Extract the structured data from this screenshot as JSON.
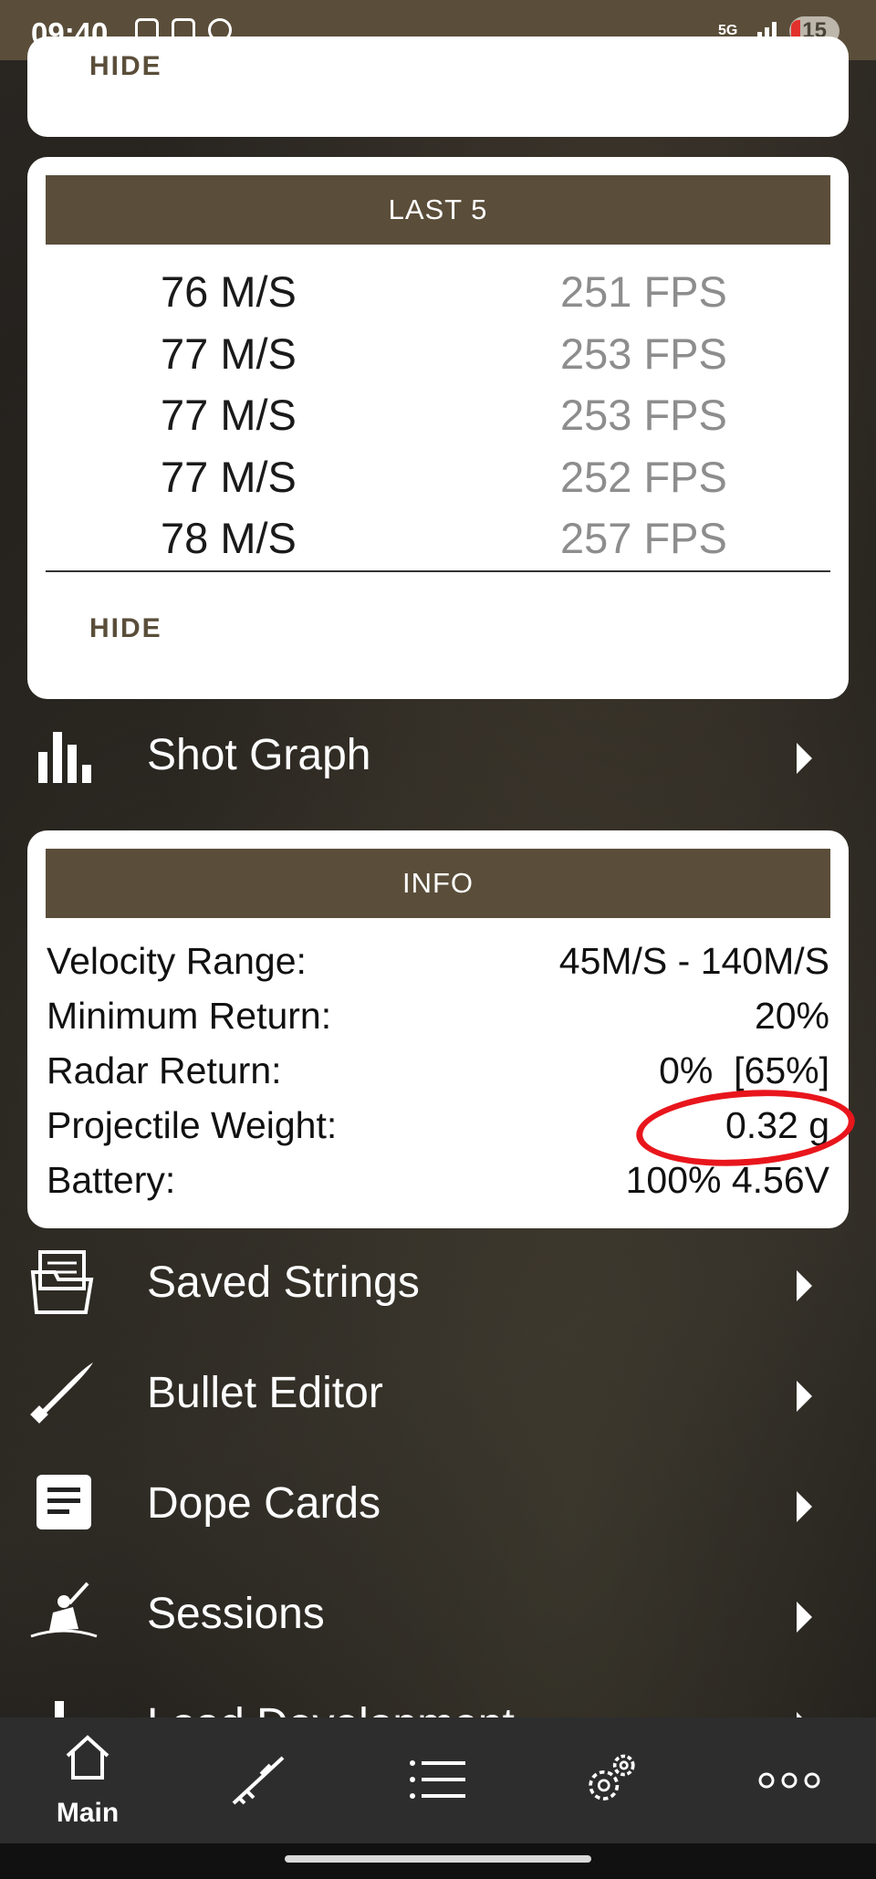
{
  "status_bar": {
    "time": "09:40",
    "network": "5G",
    "battery": "15"
  },
  "hide_label": "HIDE",
  "last5": {
    "title": "LAST 5",
    "rows": [
      {
        "ms": "76 M/S",
        "fps": "251 FPS"
      },
      {
        "ms": "77 M/S",
        "fps": "253 FPS"
      },
      {
        "ms": "77 M/S",
        "fps": "253 FPS"
      },
      {
        "ms": "77 M/S",
        "fps": "252 FPS"
      },
      {
        "ms": "78 M/S",
        "fps": "257 FPS"
      }
    ],
    "hide_label": "HIDE"
  },
  "shot_graph": {
    "label": "Shot Graph",
    "icon": "bar-chart-icon"
  },
  "info": {
    "title": "INFO",
    "rows": [
      {
        "key": "Velocity Range:",
        "value": "45M/S - 140M/S"
      },
      {
        "key": "Minimum Return:",
        "value": "20%"
      },
      {
        "key": "Radar Return:",
        "value": "0%  [65%]"
      },
      {
        "key": "Projectile Weight:",
        "value": "0.32 g"
      },
      {
        "key": "Battery:",
        "value": "100% 4.56V"
      }
    ]
  },
  "menu": [
    {
      "label": "Saved Strings",
      "icon": "folder-icon"
    },
    {
      "label": "Bullet Editor",
      "icon": "bullet-icon"
    },
    {
      "label": "Dope Cards",
      "icon": "document-icon"
    },
    {
      "label": "Sessions",
      "icon": "shooter-icon"
    },
    {
      "label": "Load Development",
      "icon": "bar-icon"
    }
  ],
  "bottom_nav": {
    "items": [
      {
        "label": "Main",
        "icon": "home-icon"
      },
      {
        "label": "",
        "icon": "rifle-icon"
      },
      {
        "label": "",
        "icon": "list-icon"
      },
      {
        "label": "",
        "icon": "gear-icon"
      },
      {
        "label": "",
        "icon": "more-icon"
      }
    ]
  },
  "colors": {
    "accent": "#5a4e3a",
    "annotation": "#e8161c"
  }
}
